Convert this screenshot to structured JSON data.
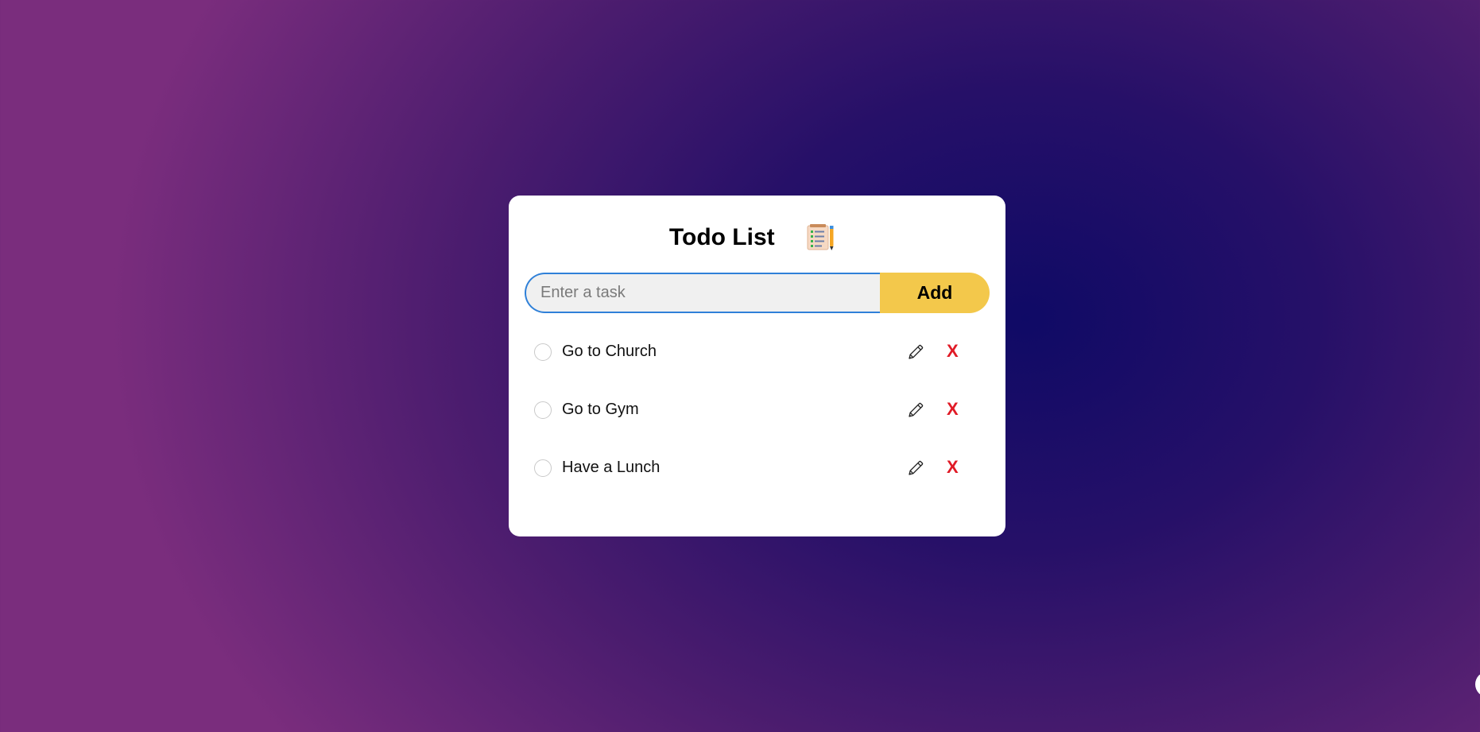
{
  "app": {
    "title": "Todo List",
    "title_icon": "checklist-notepad-icon"
  },
  "input": {
    "placeholder": "Enter a task",
    "value": ""
  },
  "add_button": {
    "label": "Add"
  },
  "todos": [
    {
      "text": "Go to Church",
      "completed": false,
      "edit_icon": "pencil-icon",
      "delete_label": "X"
    },
    {
      "text": "Go to Gym",
      "completed": false,
      "edit_icon": "pencil-icon",
      "delete_label": "X"
    },
    {
      "text": "Have a Lunch",
      "completed": false,
      "edit_icon": "pencil-icon",
      "delete_label": "X"
    }
  ],
  "colors": {
    "background_center": "#0f0a66",
    "background_edge": "#7a2d7d",
    "card": "#ffffff",
    "add_button": "#f3c84b",
    "delete": "#e01a26",
    "input_border": "#2f80d8",
    "input_bg": "#f0f0f0"
  }
}
